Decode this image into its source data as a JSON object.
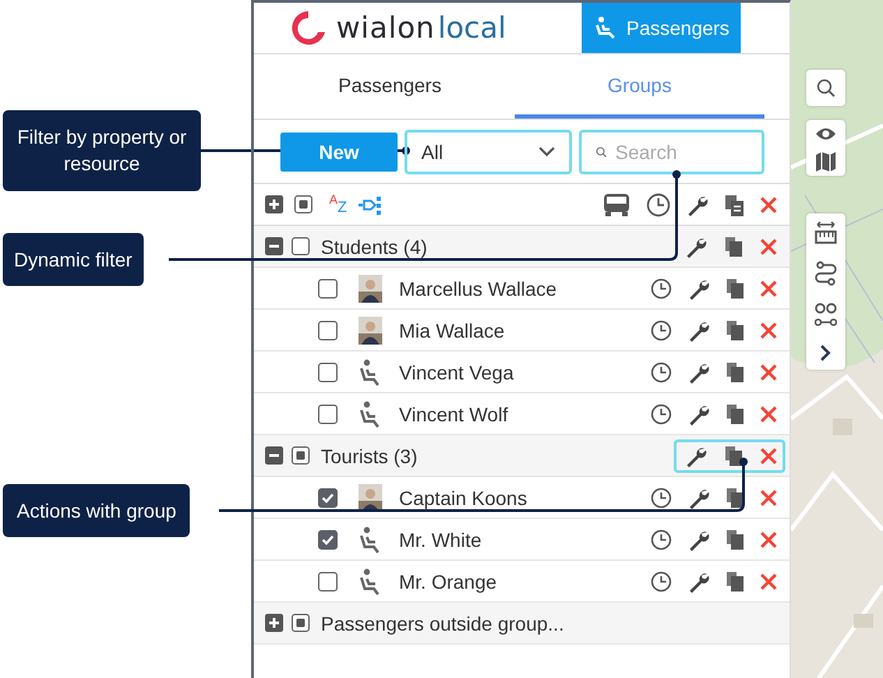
{
  "callouts": [
    {
      "text": "Filter by property or resource"
    },
    {
      "text": "Dynamic filter"
    },
    {
      "text": "Actions with group"
    }
  ],
  "header": {
    "logo": {
      "first": "wialon",
      "second": "local"
    },
    "app_button": "Passengers"
  },
  "tabs": [
    {
      "label": "Passengers",
      "selected": false
    },
    {
      "label": "Groups",
      "selected": true
    }
  ],
  "toolbar": {
    "new_button": "New",
    "filter": {
      "value": "All",
      "highlighted": true
    },
    "search": {
      "placeholder": "Search",
      "highlighted": true
    },
    "select_partial": true,
    "sort": {
      "top": "A",
      "bottom": "Z"
    }
  },
  "groups": [
    {
      "name": "Students (4)",
      "expanded": true,
      "partial": false,
      "actions": true,
      "highlighted": false,
      "members": [
        {
          "name": "Marcellus Wallace",
          "checked": false
        },
        {
          "name": "Mia Wallace",
          "checked": false
        },
        {
          "name": "Vincent Vega",
          "checked": false,
          "kind": "seat"
        },
        {
          "name": "Vincent Wolf",
          "checked": false,
          "kind": "seat"
        }
      ]
    },
    {
      "name": "Tourists (3)",
      "expanded": true,
      "partial": true,
      "actions": true,
      "highlighted": true,
      "members": [
        {
          "name": "Captain Koons",
          "checked": true
        },
        {
          "name": "Mr. White",
          "checked": true,
          "kind": "seat"
        },
        {
          "name": "Mr. Orange",
          "checked": false,
          "kind": "seat"
        }
      ]
    },
    {
      "name": "Passengers outside group...",
      "expanded": false,
      "partial": true,
      "actions": false
    }
  ]
}
